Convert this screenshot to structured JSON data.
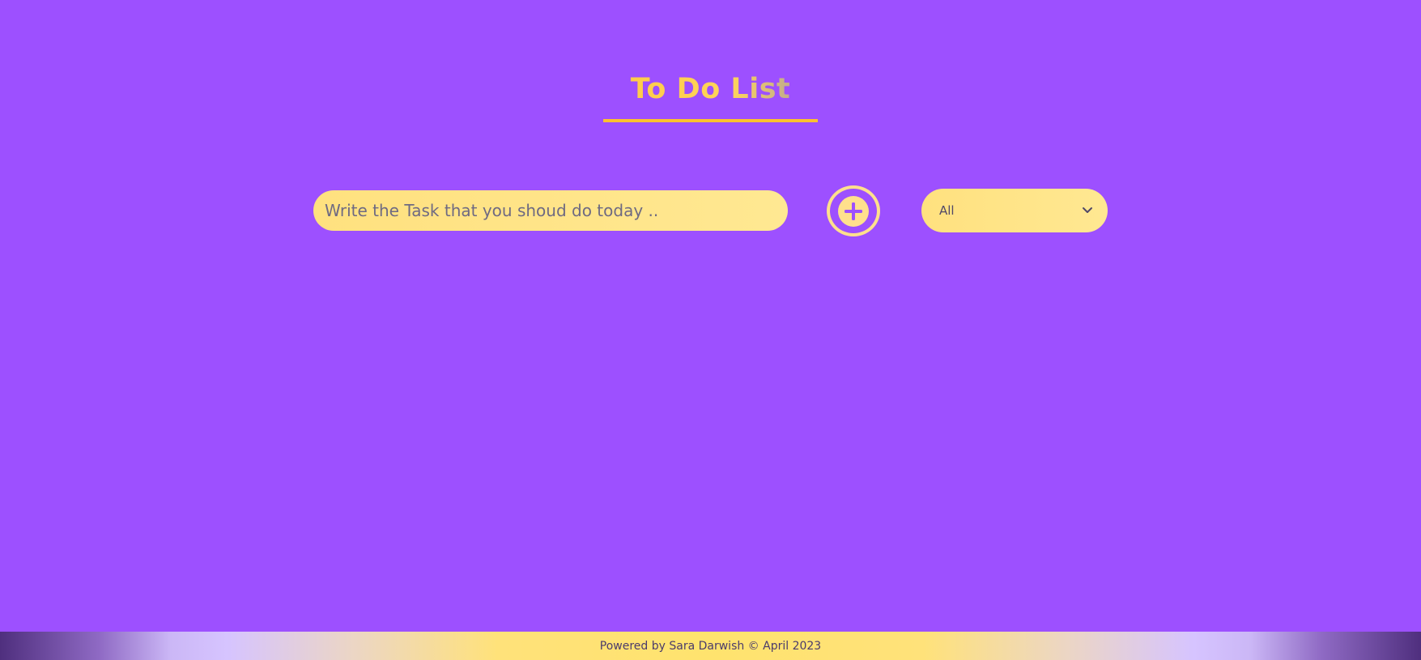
{
  "header": {
    "title": "To Do List"
  },
  "task_form": {
    "input_placeholder": "Write the Task that you shoud do today ..",
    "input_value": "",
    "add_icon": "plus-circle-icon"
  },
  "filter": {
    "selected": "All",
    "dropdown_icon": "chevron-down-icon"
  },
  "footer": {
    "text": "Powered by Sara Darwish © April 2023"
  },
  "colors": {
    "background": "#9d50ff",
    "accent_yellow": "#ffc12e",
    "input_fill": "#ffe48a",
    "text_dark": "#504868"
  }
}
